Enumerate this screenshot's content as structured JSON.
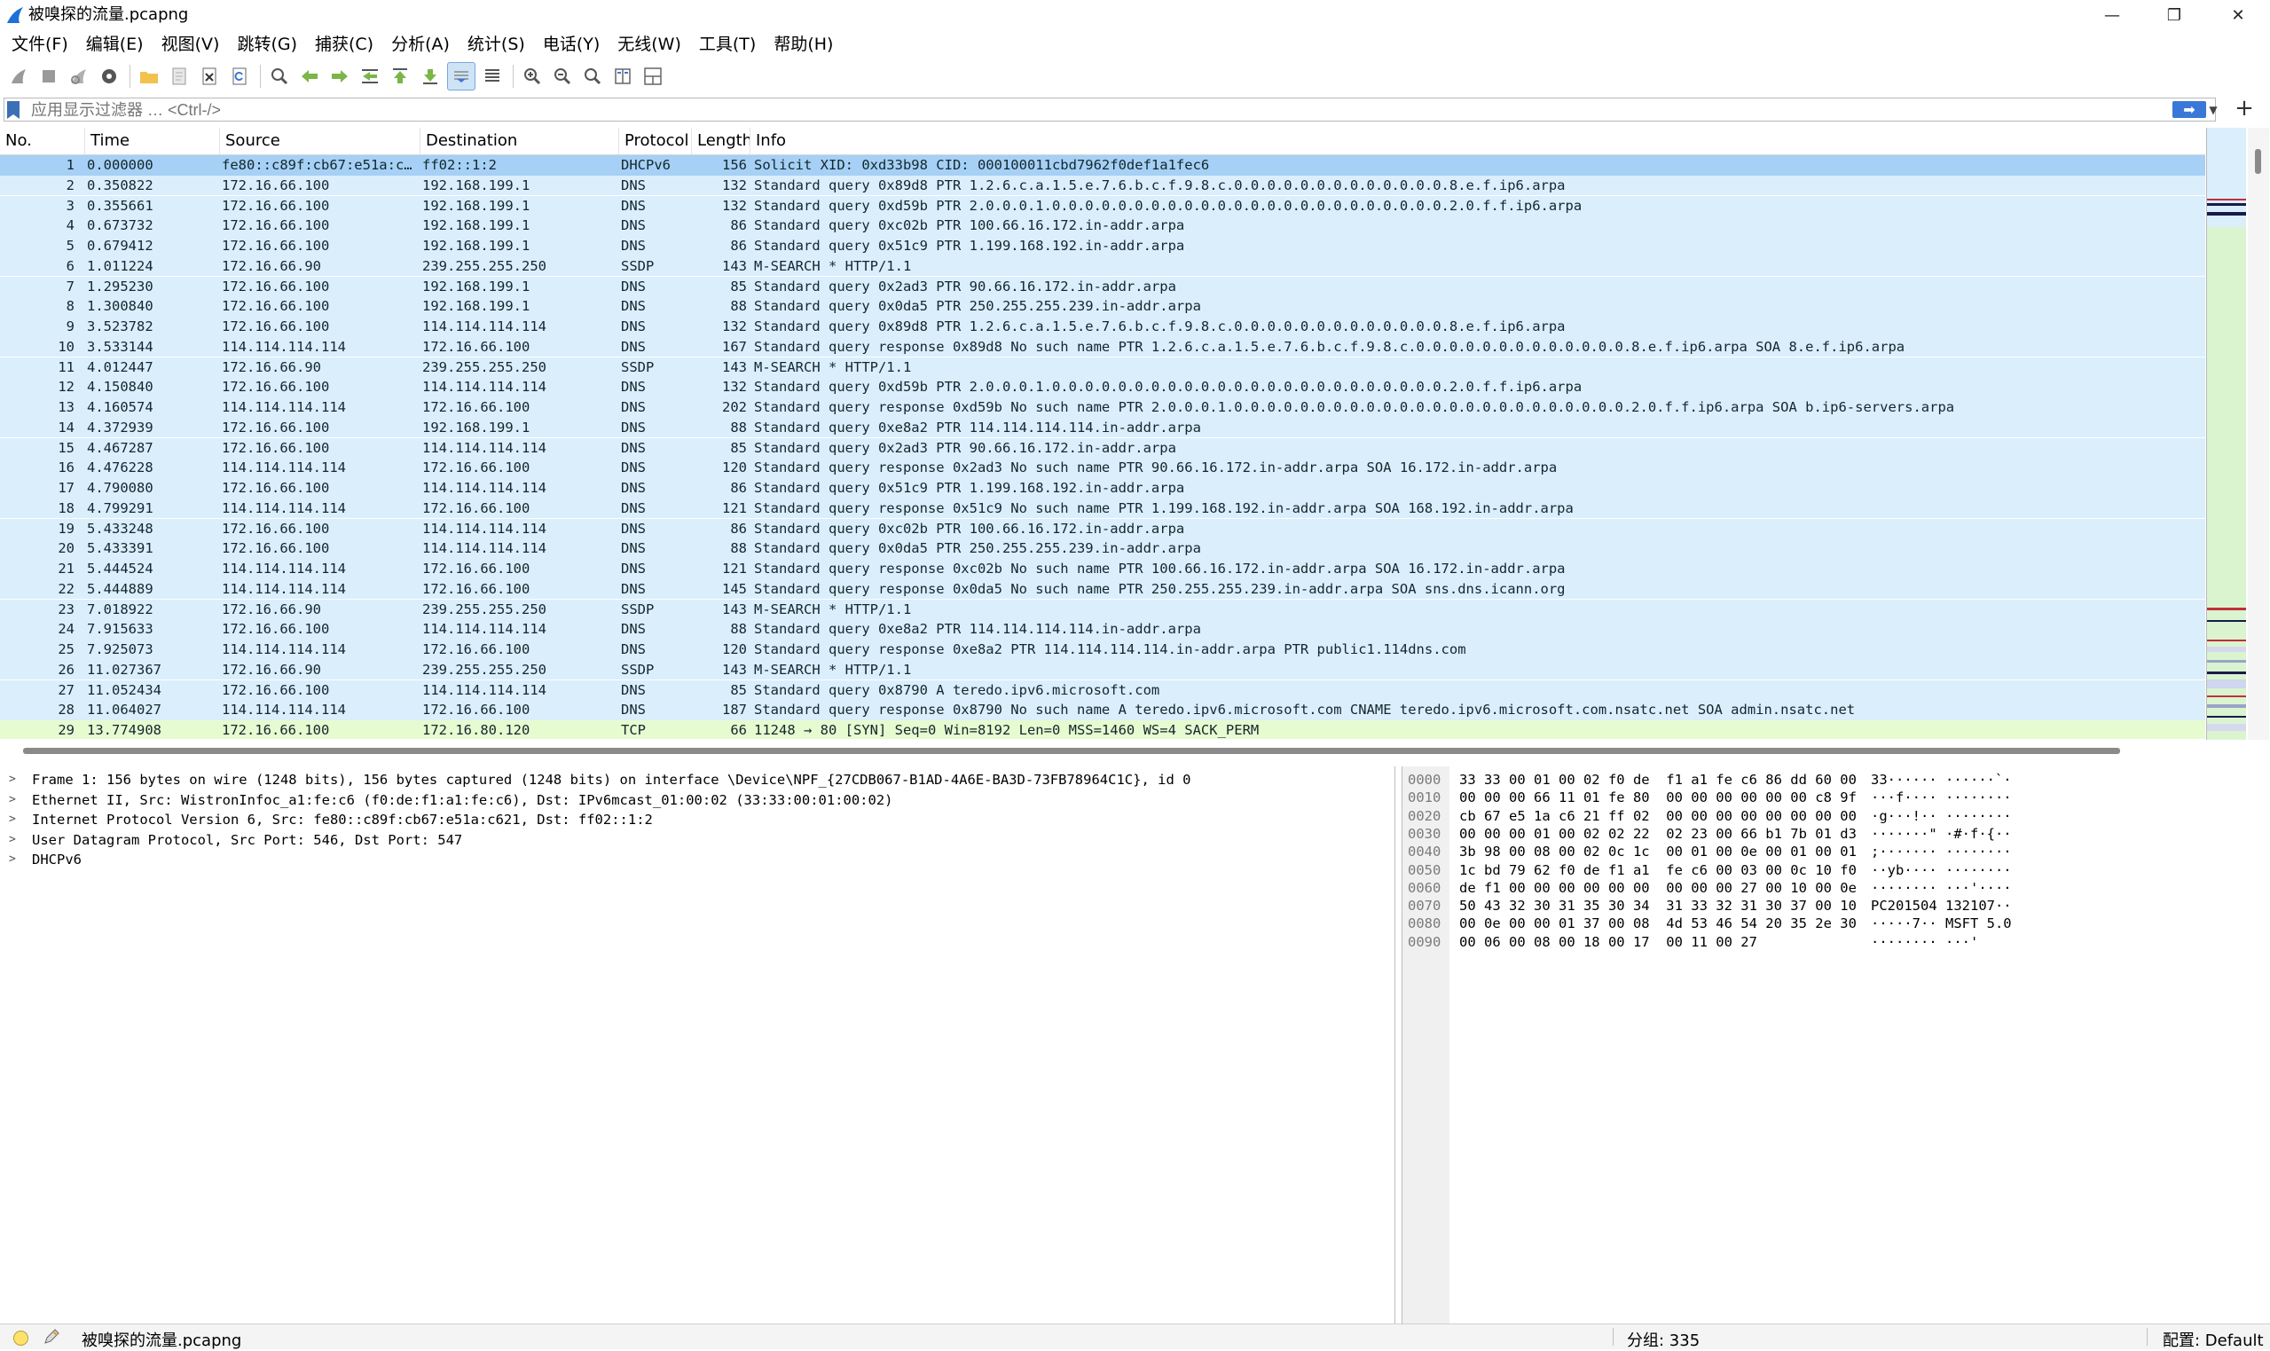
{
  "window": {
    "title": "被嗅探的流量.pcapng",
    "icon": "wireshark-fin-icon",
    "controls": [
      "minimize-icon",
      "restore-icon",
      "close-icon"
    ]
  },
  "menu": [
    "文件(F)",
    "编辑(E)",
    "视图(V)",
    "跳转(G)",
    "捕获(C)",
    "分析(A)",
    "统计(S)",
    "电话(Y)",
    "无线(W)",
    "工具(T)",
    "帮助(H)"
  ],
  "toolbar": {
    "icons": [
      "start-capture-icon",
      "stop-capture-icon",
      "restart-capture-icon",
      "capture-options-icon",
      "open-file-icon",
      "save-file-icon",
      "close-file-icon",
      "reload-file-icon",
      "find-packet-icon",
      "go-back-icon",
      "go-forward-icon",
      "go-to-packet-icon",
      "first-packet-icon",
      "last-packet-icon",
      "autoscroll-icon",
      "colorize-icon",
      "zoom-in-icon",
      "zoom-out-icon",
      "normal-size-icon",
      "resize-columns-icon",
      "layout-icon"
    ]
  },
  "filter": {
    "placeholder": "应用显示过滤器 … <Ctrl-/>",
    "apply_label": "➡",
    "add_label": "+"
  },
  "packet_list": {
    "columns": [
      "No.",
      "Time",
      "Source",
      "Destination",
      "Protocol",
      "Length",
      "Info"
    ],
    "colors": {
      "selected": "#a6d0f5",
      "udp": "#dbeefc",
      "tcp": "#e7fbd0",
      "text": "#12272e"
    },
    "rows": [
      {
        "no": "1",
        "time": "0.000000",
        "src": "fe80::c89f:cb67:e51a:c…",
        "dst": "ff02::1:2",
        "proto": "DHCPv6",
        "len": "156",
        "info": "Solicit XID: 0xd33b98 CID: 000100011cbd7962f0def1a1fec6",
        "kind": "selected"
      },
      {
        "no": "2",
        "time": "0.350822",
        "src": "172.16.66.100",
        "dst": "192.168.199.1",
        "proto": "DNS",
        "len": "132",
        "info": "Standard query 0x89d8 PTR 1.2.6.c.a.1.5.e.7.6.b.c.f.9.8.c.0.0.0.0.0.0.0.0.0.0.0.0.0.8.e.f.ip6.arpa",
        "kind": "udp"
      },
      {
        "no": "3",
        "time": "0.355661",
        "src": "172.16.66.100",
        "dst": "192.168.199.1",
        "proto": "DNS",
        "len": "132",
        "info": "Standard query 0xd59b PTR 2.0.0.0.1.0.0.0.0.0.0.0.0.0.0.0.0.0.0.0.0.0.0.0.0.0.0.0.0.2.0.f.f.ip6.arpa",
        "kind": "udp"
      },
      {
        "no": "4",
        "time": "0.673732",
        "src": "172.16.66.100",
        "dst": "192.168.199.1",
        "proto": "DNS",
        "len": "86",
        "info": "Standard query 0xc02b PTR 100.66.16.172.in-addr.arpa",
        "kind": "udp"
      },
      {
        "no": "5",
        "time": "0.679412",
        "src": "172.16.66.100",
        "dst": "192.168.199.1",
        "proto": "DNS",
        "len": "86",
        "info": "Standard query 0x51c9 PTR 1.199.168.192.in-addr.arpa",
        "kind": "udp"
      },
      {
        "no": "6",
        "time": "1.011224",
        "src": "172.16.66.90",
        "dst": "239.255.255.250",
        "proto": "SSDP",
        "len": "143",
        "info": "M-SEARCH * HTTP/1.1",
        "kind": "udp"
      },
      {
        "no": "7",
        "time": "1.295230",
        "src": "172.16.66.100",
        "dst": "192.168.199.1",
        "proto": "DNS",
        "len": "85",
        "info": "Standard query 0x2ad3 PTR 90.66.16.172.in-addr.arpa",
        "kind": "udp"
      },
      {
        "no": "8",
        "time": "1.300840",
        "src": "172.16.66.100",
        "dst": "192.168.199.1",
        "proto": "DNS",
        "len": "88",
        "info": "Standard query 0x0da5 PTR 250.255.255.239.in-addr.arpa",
        "kind": "udp"
      },
      {
        "no": "9",
        "time": "3.523782",
        "src": "172.16.66.100",
        "dst": "114.114.114.114",
        "proto": "DNS",
        "len": "132",
        "info": "Standard query 0x89d8 PTR 1.2.6.c.a.1.5.e.7.6.b.c.f.9.8.c.0.0.0.0.0.0.0.0.0.0.0.0.0.8.e.f.ip6.arpa",
        "kind": "udp"
      },
      {
        "no": "10",
        "time": "3.533144",
        "src": "114.114.114.114",
        "dst": "172.16.66.100",
        "proto": "DNS",
        "len": "167",
        "info": "Standard query response 0x89d8 No such name PTR 1.2.6.c.a.1.5.e.7.6.b.c.f.9.8.c.0.0.0.0.0.0.0.0.0.0.0.0.0.8.e.f.ip6.arpa SOA 8.e.f.ip6.arpa",
        "kind": "udp"
      },
      {
        "no": "11",
        "time": "4.012447",
        "src": "172.16.66.90",
        "dst": "239.255.255.250",
        "proto": "SSDP",
        "len": "143",
        "info": "M-SEARCH * HTTP/1.1",
        "kind": "udp"
      },
      {
        "no": "12",
        "time": "4.150840",
        "src": "172.16.66.100",
        "dst": "114.114.114.114",
        "proto": "DNS",
        "len": "132",
        "info": "Standard query 0xd59b PTR 2.0.0.0.1.0.0.0.0.0.0.0.0.0.0.0.0.0.0.0.0.0.0.0.0.0.0.0.0.2.0.f.f.ip6.arpa",
        "kind": "udp"
      },
      {
        "no": "13",
        "time": "4.160574",
        "src": "114.114.114.114",
        "dst": "172.16.66.100",
        "proto": "DNS",
        "len": "202",
        "info": "Standard query response 0xd59b No such name PTR 2.0.0.0.1.0.0.0.0.0.0.0.0.0.0.0.0.0.0.0.0.0.0.0.0.0.0.0.0.2.0.f.f.ip6.arpa SOA b.ip6-servers.arpa",
        "kind": "udp"
      },
      {
        "no": "14",
        "time": "4.372939",
        "src": "172.16.66.100",
        "dst": "192.168.199.1",
        "proto": "DNS",
        "len": "88",
        "info": "Standard query 0xe8a2 PTR 114.114.114.114.in-addr.arpa",
        "kind": "udp"
      },
      {
        "no": "15",
        "time": "4.467287",
        "src": "172.16.66.100",
        "dst": "114.114.114.114",
        "proto": "DNS",
        "len": "85",
        "info": "Standard query 0x2ad3 PTR 90.66.16.172.in-addr.arpa",
        "kind": "udp"
      },
      {
        "no": "16",
        "time": "4.476228",
        "src": "114.114.114.114",
        "dst": "172.16.66.100",
        "proto": "DNS",
        "len": "120",
        "info": "Standard query response 0x2ad3 No such name PTR 90.66.16.172.in-addr.arpa SOA 16.172.in-addr.arpa",
        "kind": "udp"
      },
      {
        "no": "17",
        "time": "4.790080",
        "src": "172.16.66.100",
        "dst": "114.114.114.114",
        "proto": "DNS",
        "len": "86",
        "info": "Standard query 0x51c9 PTR 1.199.168.192.in-addr.arpa",
        "kind": "udp"
      },
      {
        "no": "18",
        "time": "4.799291",
        "src": "114.114.114.114",
        "dst": "172.16.66.100",
        "proto": "DNS",
        "len": "121",
        "info": "Standard query response 0x51c9 No such name PTR 1.199.168.192.in-addr.arpa SOA 168.192.in-addr.arpa",
        "kind": "udp"
      },
      {
        "no": "19",
        "time": "5.433248",
        "src": "172.16.66.100",
        "dst": "114.114.114.114",
        "proto": "DNS",
        "len": "86",
        "info": "Standard query 0xc02b PTR 100.66.16.172.in-addr.arpa",
        "kind": "udp"
      },
      {
        "no": "20",
        "time": "5.433391",
        "src": "172.16.66.100",
        "dst": "114.114.114.114",
        "proto": "DNS",
        "len": "88",
        "info": "Standard query 0x0da5 PTR 250.255.255.239.in-addr.arpa",
        "kind": "udp"
      },
      {
        "no": "21",
        "time": "5.444524",
        "src": "114.114.114.114",
        "dst": "172.16.66.100",
        "proto": "DNS",
        "len": "121",
        "info": "Standard query response 0xc02b No such name PTR 100.66.16.172.in-addr.arpa SOA 16.172.in-addr.arpa",
        "kind": "udp"
      },
      {
        "no": "22",
        "time": "5.444889",
        "src": "114.114.114.114",
        "dst": "172.16.66.100",
        "proto": "DNS",
        "len": "145",
        "info": "Standard query response 0x0da5 No such name PTR 250.255.255.239.in-addr.arpa SOA sns.dns.icann.org",
        "kind": "udp"
      },
      {
        "no": "23",
        "time": "7.018922",
        "src": "172.16.66.90",
        "dst": "239.255.255.250",
        "proto": "SSDP",
        "len": "143",
        "info": "M-SEARCH * HTTP/1.1",
        "kind": "udp"
      },
      {
        "no": "24",
        "time": "7.915633",
        "src": "172.16.66.100",
        "dst": "114.114.114.114",
        "proto": "DNS",
        "len": "88",
        "info": "Standard query 0xe8a2 PTR 114.114.114.114.in-addr.arpa",
        "kind": "udp"
      },
      {
        "no": "25",
        "time": "7.925073",
        "src": "114.114.114.114",
        "dst": "172.16.66.100",
        "proto": "DNS",
        "len": "120",
        "info": "Standard query response 0xe8a2 PTR 114.114.114.114.in-addr.arpa PTR public1.114dns.com",
        "kind": "udp"
      },
      {
        "no": "26",
        "time": "11.027367",
        "src": "172.16.66.90",
        "dst": "239.255.255.250",
        "proto": "SSDP",
        "len": "143",
        "info": "M-SEARCH * HTTP/1.1",
        "kind": "udp"
      },
      {
        "no": "27",
        "time": "11.052434",
        "src": "172.16.66.100",
        "dst": "114.114.114.114",
        "proto": "DNS",
        "len": "85",
        "info": "Standard query 0x8790 A teredo.ipv6.microsoft.com",
        "kind": "udp"
      },
      {
        "no": "28",
        "time": "11.064027",
        "src": "114.114.114.114",
        "dst": "172.16.66.100",
        "proto": "DNS",
        "len": "187",
        "info": "Standard query response 0x8790 No such name A teredo.ipv6.microsoft.com CNAME teredo.ipv6.microsoft.com.nsatc.net SOA admin.nsatc.net",
        "kind": "udp"
      },
      {
        "no": "29",
        "time": "13.774908",
        "src": "172.16.66.100",
        "dst": "172.16.80.120",
        "proto": "TCP",
        "len": "66",
        "info": "11248 → 80 [SYN] Seq=0 Win=8192 Len=0 MSS=1460 WS=4 SACK_PERM",
        "kind": "tcp"
      }
    ]
  },
  "details": [
    "Frame 1: 156 bytes on wire (1248 bits), 156 bytes captured (1248 bits) on interface \\Device\\NPF_{27CDB067-B1AD-4A6E-BA3D-73FB78964C1C}, id 0",
    "Ethernet II, Src: WistronInfoc_a1:fe:c6 (f0:de:f1:a1:fe:c6), Dst: IPv6mcast_01:00:02 (33:33:00:01:00:02)",
    "Internet Protocol Version 6, Src: fe80::c89f:cb67:e51a:c621, Dst: ff02::1:2",
    "User Datagram Protocol, Src Port: 546, Dst Port: 547",
    "DHCPv6"
  ],
  "hex": [
    {
      "off": "0000",
      "bytes": "33 33 00 01 00 02 f0 de  f1 a1 fe c6 86 dd 60 00",
      "ascii": "33······ ······`·"
    },
    {
      "off": "0010",
      "bytes": "00 00 00 66 11 01 fe 80  00 00 00 00 00 00 c8 9f",
      "ascii": "···f···· ········"
    },
    {
      "off": "0020",
      "bytes": "cb 67 e5 1a c6 21 ff 02  00 00 00 00 00 00 00 00",
      "ascii": "·g···!·· ········"
    },
    {
      "off": "0030",
      "bytes": "00 00 00 01 00 02 02 22  02 23 00 66 b1 7b 01 d3",
      "ascii": "·······\" ·#·f·{··"
    },
    {
      "off": "0040",
      "bytes": "3b 98 00 08 00 02 0c 1c  00 01 00 0e 00 01 00 01",
      "ascii": ";······· ········"
    },
    {
      "off": "0050",
      "bytes": "1c bd 79 62 f0 de f1 a1  fe c6 00 03 00 0c 10 f0",
      "ascii": "··yb···· ········"
    },
    {
      "off": "0060",
      "bytes": "de f1 00 00 00 00 00 00  00 00 00 27 00 10 00 0e",
      "ascii": "········ ···'····"
    },
    {
      "off": "0070",
      "bytes": "50 43 32 30 31 35 30 34  31 33 32 31 30 37 00 10",
      "ascii": "PC201504 132107··"
    },
    {
      "off": "0080",
      "bytes": "00 0e 00 00 01 37 00 08  4d 53 46 54 20 35 2e 30",
      "ascii": "·····7·· MSFT 5.0"
    },
    {
      "off": "0090",
      "bytes": "00 06 00 08 00 18 00 17  00 11 00 27",
      "ascii": "········ ···'"
    }
  ],
  "status": {
    "file": "被嗅探的流量.pcapng",
    "packets": "分组: 335",
    "profile": "配置: Default"
  }
}
